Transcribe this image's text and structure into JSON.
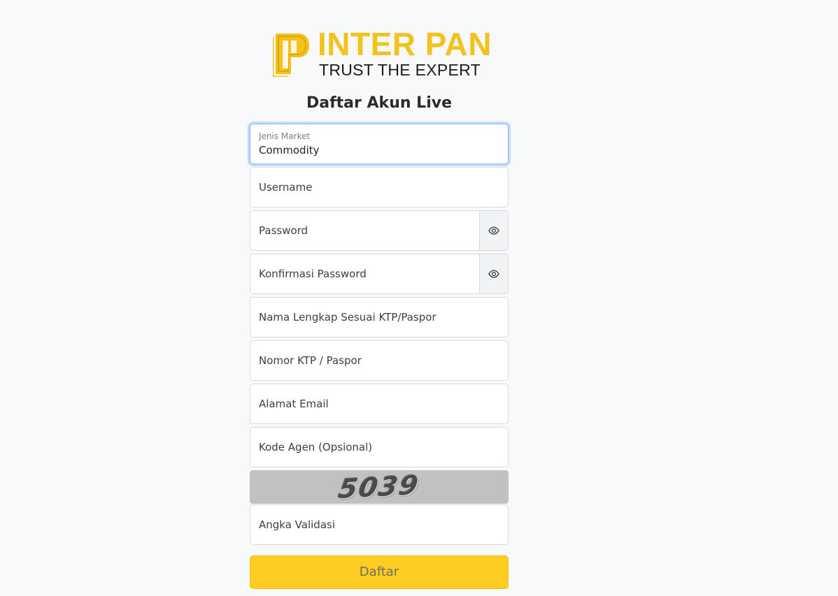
{
  "brand": {
    "name": "INTER PAN",
    "tagline": "TRUST THE EXPERT",
    "color": "#f4c21f"
  },
  "form": {
    "title": "Daftar Akun Live",
    "market_type": {
      "label": "Jenis Market",
      "value": "Commodity"
    },
    "username": {
      "placeholder": "Username"
    },
    "password": {
      "placeholder": "Password",
      "toggle_icon": "eye-icon"
    },
    "confirm_password": {
      "placeholder": "Konfirmasi Password",
      "toggle_icon": "eye-icon"
    },
    "full_name": {
      "placeholder": "Nama Lengkap Sesuai KTP/Paspor"
    },
    "id_number": {
      "placeholder": "Nomor KTP / Paspor"
    },
    "email": {
      "placeholder": "Alamat Email"
    },
    "agent_code": {
      "placeholder": "Kode Agen (Opsional)"
    },
    "captcha": {
      "text": "5039"
    },
    "validation_code": {
      "placeholder": "Angka Validasi"
    },
    "submit_label": "Daftar",
    "submit_color": "#ffcd22"
  }
}
